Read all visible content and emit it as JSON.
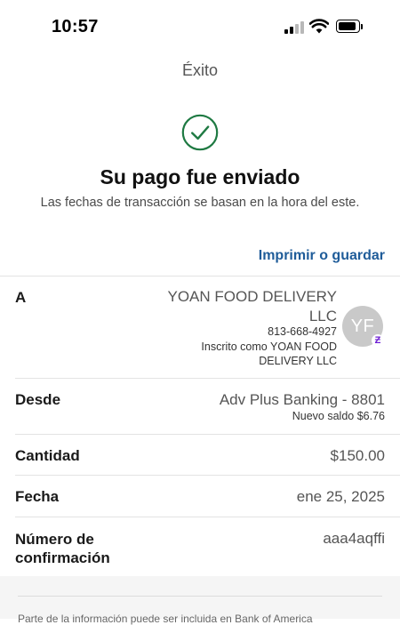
{
  "status_bar": {
    "time": "10:57"
  },
  "nav": {
    "title": "Éxito"
  },
  "confirmation": {
    "heading": "Su pago fue enviado",
    "subheading": "Las fechas de transacción se basan en la hora del este.",
    "print_link": "Imprimir o guardar",
    "accent_color": "#1f5c99",
    "success_color": "#1f7a43"
  },
  "details": {
    "to": {
      "label": "A",
      "name": "YOAN FOOD DELIVERY LLC",
      "phone": "813-668-4927",
      "registered_as": "Inscrito como YOAN FOOD DELIVERY LLC",
      "avatar_initials": "YF",
      "badge_icon": "zelle-icon"
    },
    "from": {
      "label": "Desde",
      "account": "Adv Plus Banking - 8801",
      "balance": "Nuevo saldo $6.76"
    },
    "amount": {
      "label": "Cantidad",
      "value": "$150.00"
    },
    "date": {
      "label": "Fecha",
      "value": "ene 25, 2025"
    },
    "confirmation_number": {
      "label": "Número de confirmación",
      "value": "aaa4aqffi"
    }
  },
  "footer": {
    "text": "Parte de la información puede ser incluida en Bank of America"
  }
}
